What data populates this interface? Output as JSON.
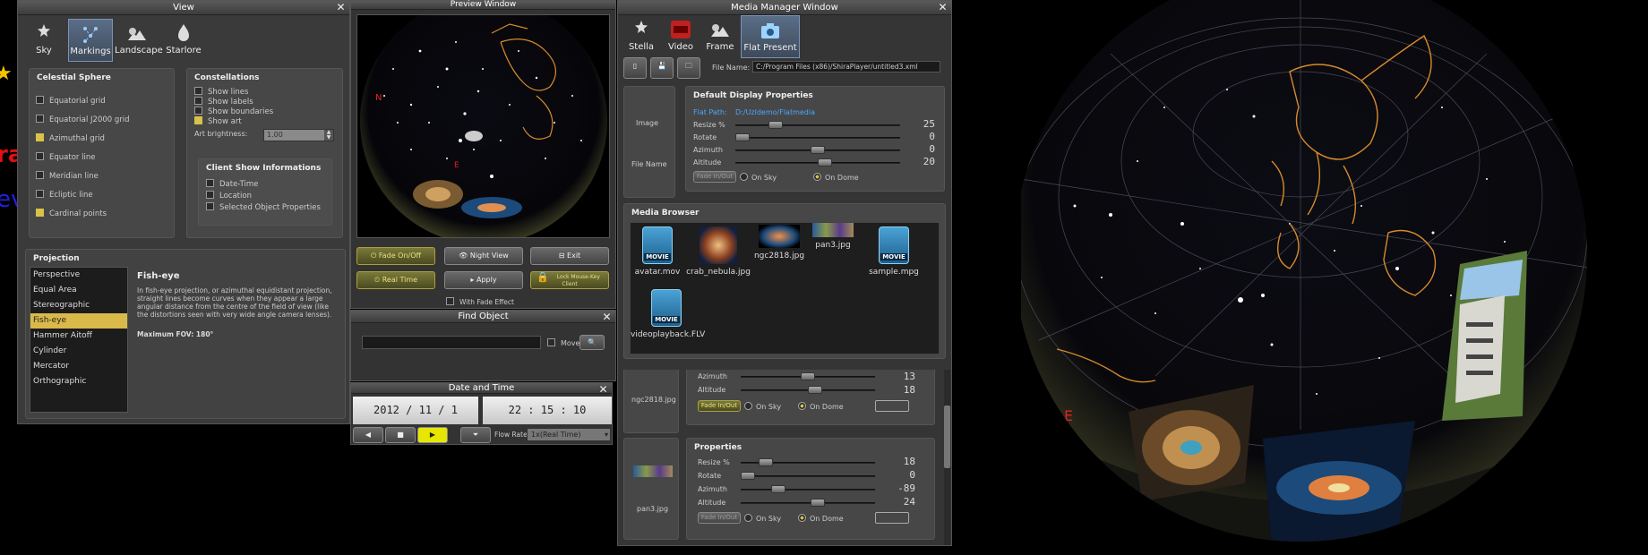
{
  "left_fragment": {
    "text1": "ra",
    "text2": "ev"
  },
  "view": {
    "title": "View",
    "tabs": [
      {
        "label": "Sky"
      },
      {
        "label": "Markings"
      },
      {
        "label": "Landscape"
      },
      {
        "label": "Starlore"
      }
    ],
    "celestial": {
      "title": "Celestial Sphere",
      "items": [
        {
          "label": "Equatorial grid",
          "checked": false
        },
        {
          "label": "Equatorial J2000 grid",
          "checked": false
        },
        {
          "label": "Azimuthal grid",
          "checked": true
        },
        {
          "label": "Equator line",
          "checked": false
        },
        {
          "label": "Meridian line",
          "checked": false
        },
        {
          "label": "Ecliptic line",
          "checked": false
        },
        {
          "label": "Cardinal points",
          "checked": true
        }
      ]
    },
    "constellations": {
      "title": "Constellations",
      "items": [
        {
          "label": "Show lines",
          "checked": false
        },
        {
          "label": "Show labels",
          "checked": false
        },
        {
          "label": "Show boundaries",
          "checked": false
        },
        {
          "label": "Show art",
          "checked": true
        }
      ],
      "art_brightness_label": "Art brightness:",
      "art_brightness_value": "1.00"
    },
    "client_info": {
      "title": "Client Show Informations",
      "items": [
        {
          "label": "Date-Time",
          "checked": false
        },
        {
          "label": "Location",
          "checked": false
        },
        {
          "label": "Selected Object Properties",
          "checked": false
        }
      ]
    },
    "projection": {
      "title": "Projection",
      "options": [
        "Perspective",
        "Equal Area",
        "Stereographic",
        "Fish-eye",
        "Hammer Aitoff",
        "Cylinder",
        "Mercator",
        "Orthographic"
      ],
      "selected": "Fish-eye",
      "desc_title": "Fish-eye",
      "desc_text": "In fish-eye projection, or azimuthal equidistant projection, straight lines become curves when they appear a large angular distance from the centre of the field of view (like the distortions seen with very wide angle camera lenses).",
      "max_fov": "Maximum FOV: 180°"
    }
  },
  "preview": {
    "title": "Preview Window",
    "buttons": {
      "fade": "Fade On/Off",
      "night": "Night View",
      "exit": "Exit",
      "realtime": "Real Time",
      "apply": "Apply",
      "lock": "Lock Mouse-Key Client"
    },
    "with_fade": "With Fade Effect",
    "cardinal": "E"
  },
  "find": {
    "title": "Find Object",
    "move": "Move"
  },
  "datetime": {
    "title": "Date and Time",
    "year": "2012",
    "month": "11",
    "day": "1",
    "hour": "22",
    "minute": "15",
    "second": "10",
    "sep_date": "/",
    "sep_time": ":",
    "flow_label": "Flow Rate",
    "flow_value": "1x(Real Time)"
  },
  "media": {
    "title": "Media Manager Window",
    "tabs": [
      {
        "label": "Stella"
      },
      {
        "label": "Video"
      },
      {
        "label": "Frame"
      },
      {
        "label": "Flat Present"
      }
    ],
    "file_name_label": "File Name:",
    "file_name_value": "C:/Program Files (x86)/ShiraPlayer/untitled3.xml",
    "image_label": "Image",
    "filename_label": "File Name",
    "default_props": {
      "title": "Default Display Properties",
      "flat_path_label": "Flat Path:",
      "flat_path_value": "D:/Uzldemo/Flatmedia",
      "rows": [
        {
          "label": "Resize %",
          "value": "25",
          "pos": 0.22
        },
        {
          "label": "Rotate",
          "value": "0",
          "pos": 0.0
        },
        {
          "label": "Azimuth",
          "value": "0",
          "pos": 0.5
        },
        {
          "label": "Altitude",
          "value": "20",
          "pos": 0.55
        }
      ],
      "fade": "Fade In/Out",
      "on_sky": "On Sky",
      "on_dome": "On Dome"
    },
    "browser": {
      "title": "Media Browser",
      "items": [
        {
          "name": "avatar.mov",
          "kind": "movie"
        },
        {
          "name": "crab_nebula.jpg",
          "kind": "image"
        },
        {
          "name": "ngc2818.jpg",
          "kind": "image"
        },
        {
          "name": "pan3.jpg",
          "kind": "image"
        },
        {
          "name": "sample.mpg",
          "kind": "movie"
        },
        {
          "name": "videoplayback.FLV",
          "kind": "movie"
        }
      ]
    },
    "entry1": {
      "name": "ngc2818.jpg",
      "rows": [
        {
          "label": "Azimuth",
          "value": "13",
          "pos": 0.5
        },
        {
          "label": "Altitude",
          "value": "18",
          "pos": 0.56
        }
      ],
      "fade": "Fade In/Out",
      "on_sky": "On Sky",
      "on_dome": "On Dome"
    },
    "entry2": {
      "name": "pan3.jpg",
      "title": "Properties",
      "rows": [
        {
          "label": "Resize %",
          "value": "18",
          "pos": 0.15
        },
        {
          "label": "Rotate",
          "value": "0",
          "pos": 0.0
        },
        {
          "label": "Azimuth",
          "value": "-89",
          "pos": 0.25
        },
        {
          "label": "Altitude",
          "value": "24",
          "pos": 0.58
        }
      ],
      "fade": "Fade In/Out",
      "on_sky": "On Sky",
      "on_dome": "On Dome"
    }
  },
  "dome": {
    "cardinal": "E"
  }
}
